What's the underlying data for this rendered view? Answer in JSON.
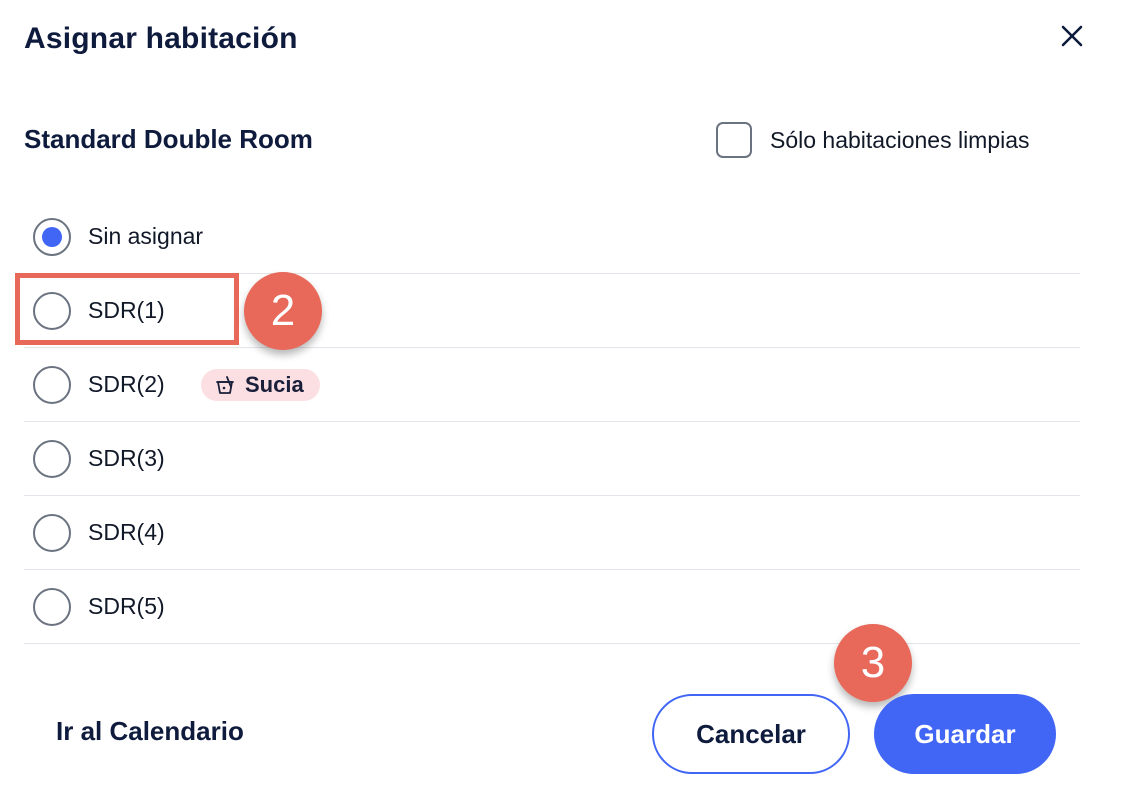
{
  "dialog": {
    "title": "Asignar habitación",
    "room_type": "Standard Double Room",
    "clean_filter_label": "Sólo habitaciones limpias",
    "clean_filter_checked": false
  },
  "rooms": [
    {
      "label": "Sin asignar",
      "selected": true
    },
    {
      "label": "SDR(1)",
      "selected": false
    },
    {
      "label": "SDR(2)",
      "selected": false,
      "badge": "Sucia"
    },
    {
      "label": "SDR(3)",
      "selected": false
    },
    {
      "label": "SDR(4)",
      "selected": false
    },
    {
      "label": "SDR(5)",
      "selected": false
    }
  ],
  "footer": {
    "calendar_link": "Ir al Calendario",
    "cancel_label": "Cancelar",
    "save_label": "Guardar"
  },
  "annotations": {
    "step_2": "2",
    "step_3": "3"
  },
  "colors": {
    "primary": "#4166f5",
    "annotation": "#e8685a",
    "dirty_badge_bg": "#fbdfe3",
    "text": "#0f1b3d"
  },
  "icons": {
    "close": "close-icon",
    "dirty": "dirty-bucket-icon"
  }
}
